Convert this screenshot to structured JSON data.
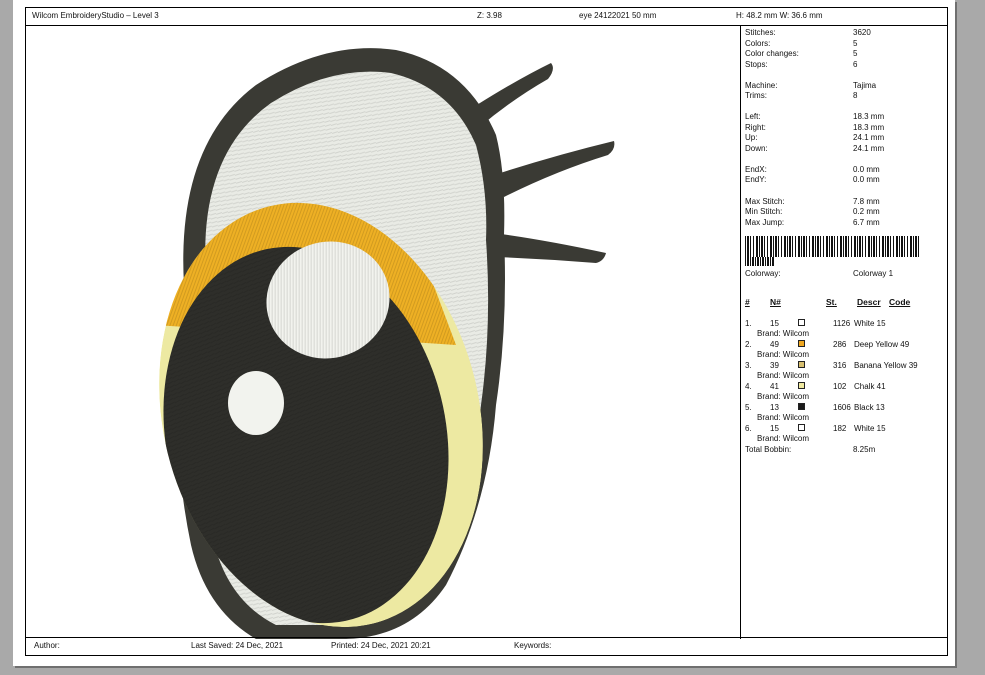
{
  "header": {
    "title": "Wilcom EmbroideryStudio – Level 3",
    "zoom": "Z: 3.98",
    "design_name": "eye 24122021 50 mm",
    "dimensions": "H: 48.2 mm   W: 36.6 mm"
  },
  "stats": [
    {
      "label": "Stitches:",
      "value": "3620"
    },
    {
      "label": "Colors:",
      "value": "5"
    },
    {
      "label": "Color changes:",
      "value": "5"
    },
    {
      "label": "Stops:",
      "value": "6"
    },
    {
      "label": "Machine:",
      "value": "Tajima"
    },
    {
      "label": "Trims:",
      "value": "8"
    },
    {
      "label": "Left:",
      "value": "18.3 mm"
    },
    {
      "label": "Right:",
      "value": "18.3 mm"
    },
    {
      "label": "Up:",
      "value": "24.1 mm"
    },
    {
      "label": "Down:",
      "value": "24.1 mm"
    },
    {
      "label": "EndX:",
      "value": "0.0 mm"
    },
    {
      "label": "EndY:",
      "value": "0.0 mm"
    },
    {
      "label": "Max Stitch:",
      "value": "7.8 mm"
    },
    {
      "label": "Min Stitch:",
      "value": "0.2 mm"
    },
    {
      "label": "Max Jump:",
      "value": "6.7 mm"
    }
  ],
  "colorway": {
    "label": "Colorway:",
    "value": "Colorway 1"
  },
  "table_headers": {
    "num": "#",
    "n": "N#",
    "st": "St.",
    "descr": "Descr",
    "code": "Code"
  },
  "colors": [
    {
      "idx": "1.",
      "n": "15",
      "swatch": "#ffffff",
      "st": "1126",
      "descr": "White 15",
      "brand": "Brand: Wilcom"
    },
    {
      "idx": "2.",
      "n": "49",
      "swatch": "#f0a820",
      "st": "286",
      "descr": "Deep Yellow 49",
      "brand": "Brand: Wilcom"
    },
    {
      "idx": "3.",
      "n": "39",
      "swatch": "#d8c070",
      "st": "316",
      "descr": "Banana Yellow 39",
      "brand": "Brand: Wilcom"
    },
    {
      "idx": "4.",
      "n": "41",
      "swatch": "#f0eaa0",
      "st": "102",
      "descr": "Chalk 41",
      "brand": "Brand: Wilcom"
    },
    {
      "idx": "5.",
      "n": "13",
      "swatch": "#1a1a1a",
      "st": "1606",
      "descr": "Black 13",
      "brand": "Brand: Wilcom"
    },
    {
      "idx": "6.",
      "n": "15",
      "swatch": "#ffffff",
      "st": "182",
      "descr": "White 15",
      "brand": "Brand: Wilcom"
    }
  ],
  "bobbin": {
    "label": "Total Bobbin:",
    "value": "8.25m"
  },
  "footer": {
    "author": "Author:",
    "saved": "Last Saved: 24 Dec, 2021",
    "printed": "Printed: 24 Dec, 2021 20:21",
    "keywords": "Keywords:"
  },
  "design_colors": {
    "outline": "#3a3a34",
    "white_fill": "#e9ebe5",
    "deep_yellow": "#eeb024",
    "chalk": "#ede9a2",
    "pupil": "#2e2e2a",
    "highlight": "#f2f3ee"
  }
}
